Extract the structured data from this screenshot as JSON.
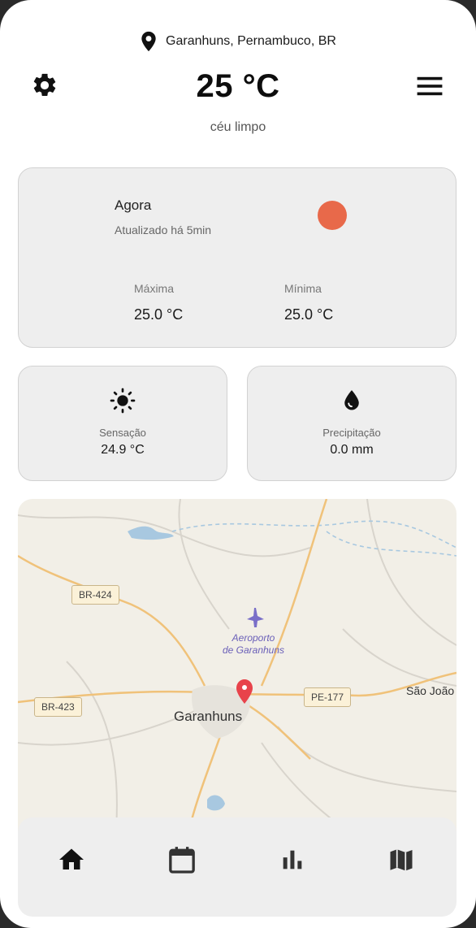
{
  "header": {
    "location": "Garanhuns, Pernambuco, BR",
    "temperature": "25 °C",
    "description": "céu limpo"
  },
  "current": {
    "title": "Agora",
    "updated": "Atualizado há 5min",
    "sun_color": "#e8694a",
    "max_label": "Máxima",
    "max_value": "25.0 °C",
    "min_label": "Mínima",
    "min_value": "25.0 °C"
  },
  "feels_like": {
    "label": "Sensação",
    "value": "24.9 °C"
  },
  "precipitation": {
    "label": "Precipitação",
    "value": "0.0 mm"
  },
  "map": {
    "labels": {
      "br424": "BR-424",
      "br423": "BR-423",
      "pe177": "PE-177",
      "airport_line1": "Aeroporto",
      "airport_line2": "de Garanhuns",
      "city": "Garanhuns",
      "sao_joao": "São João"
    },
    "marker_color": "#e8434b"
  },
  "icons": {
    "settings": "gear-icon",
    "menu": "menu-icon",
    "location": "location-pin-icon",
    "feels_like": "sun-icon",
    "precipitation": "water-drop-icon",
    "nav": [
      "home-icon",
      "calendar-icon",
      "bar-chart-icon",
      "map-icon"
    ]
  }
}
